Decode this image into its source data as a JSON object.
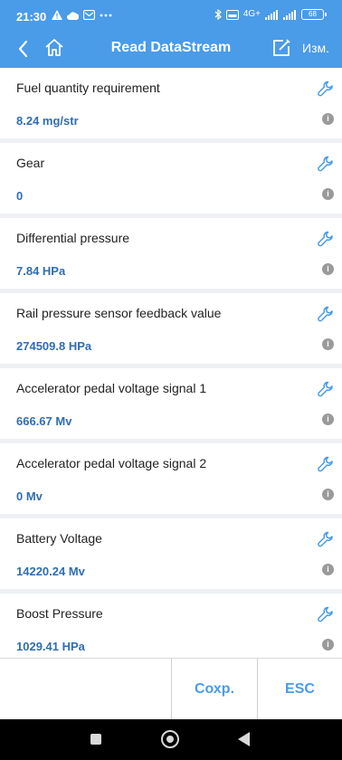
{
  "status_bar": {
    "time": "21:30",
    "network_label": "4G+",
    "battery": "68"
  },
  "header": {
    "title": "Read DataStream",
    "edit_label": "Изм."
  },
  "items": [
    {
      "name": "Fuel quantity requirement",
      "value": "8.24 mg/str"
    },
    {
      "name": "Gear",
      "value": "0"
    },
    {
      "name": "Differential pressure",
      "value": "7.84 HPa"
    },
    {
      "name": "Rail pressure sensor feedback value",
      "value": "274509.8 HPa"
    },
    {
      "name": "Accelerator pedal voltage signal 1",
      "value": "666.67 Mv"
    },
    {
      "name": "Accelerator pedal voltage signal 2",
      "value": "0 Mv"
    },
    {
      "name": "Battery Voltage",
      "value": "14220.24 Mv"
    },
    {
      "name": "Boost Pressure",
      "value": "1029.41 HPa"
    }
  ],
  "actions": {
    "save_label": "Сохр.",
    "esc_label": "ESC"
  },
  "colors": {
    "accent": "#4a9be8",
    "value_text": "#2f6db3"
  },
  "icons": [
    "warning-icon",
    "cloud-icon",
    "mail-icon",
    "bluetooth-icon",
    "signal-icon",
    "battery-icon",
    "back-arrow-icon",
    "home-icon",
    "edit-icon",
    "wrench-icon",
    "info-icon"
  ]
}
